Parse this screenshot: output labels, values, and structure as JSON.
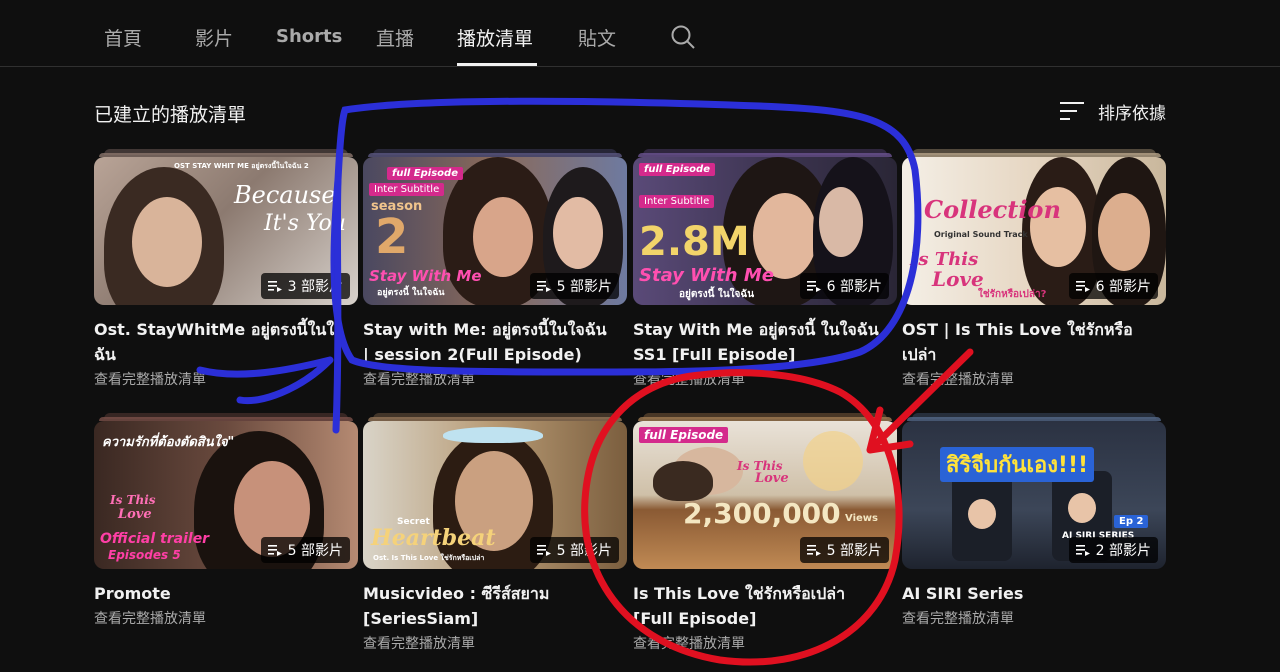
{
  "tabs": [
    {
      "label": "首頁"
    },
    {
      "label": "影片"
    },
    {
      "label": "Shorts"
    },
    {
      "label": "直播"
    },
    {
      "label": "播放清單"
    },
    {
      "label": "貼文"
    }
  ],
  "active_tab": "播放清單",
  "section": {
    "title": "已建立的播放清單",
    "sort_label": "排序依據"
  },
  "playlists": [
    {
      "title_line1": "Ost. StayWhitMe อยู่ตรงนี้ในใจ",
      "title_line2": "ฉัน",
      "video_count": "3 部影片",
      "view_all": "查看完整播放清單",
      "thumb_text": [
        "Because",
        "It's You",
        "OST STAY WHIT ME อยู่ตรงนี้ในใจฉัน 2"
      ]
    },
    {
      "title_line1": "Stay with Me: อยู่ตรงนี้ในใจฉัน",
      "title_line2": "| session 2(Full Episode)",
      "video_count": "5 部影片",
      "view_all": "查看完整播放清單",
      "thumb_text": [
        "full Episode",
        "Inter Subtitle",
        "season",
        "2",
        "Stay With Me",
        "อยู่ตรงนี้ ในใจฉัน"
      ]
    },
    {
      "title_line1": "Stay With Me อยู่ตรงนี้ ในใจฉัน",
      "title_line2": "SS1  [Full Episode]",
      "video_count": "6 部影片",
      "view_all": "查看完整播放清單",
      "thumb_text": [
        "full Episode",
        "Inter Subtitle",
        "2.8M",
        "Stay With Me",
        "อยู่ตรงนี้ ในใจฉัน"
      ]
    },
    {
      "title_line1": "OST | Is This Love ใช่รักหรือ",
      "title_line2": "เปล่า",
      "video_count": "6 部影片",
      "view_all": "查看完整播放清單",
      "thumb_text": [
        "Collection",
        "Original Sound Track",
        "Is This",
        "Love",
        "ใช่รักหรือเปล่า?"
      ]
    },
    {
      "title_line1": "Promote",
      "title_line2": "",
      "video_count": "5 部影片",
      "view_all": "查看完整播放清單",
      "thumb_text": [
        "ความรักที่ต้องตัดสินใจ\"",
        "Is This",
        "Love",
        "Official trailer",
        "Episodes 5"
      ]
    },
    {
      "title_line1": "Musicvideo : ซีรีส์สยาม",
      "title_line2": "[SeriesSiam]",
      "video_count": "5 部影片",
      "view_all": "查看完整播放清單",
      "thumb_text": [
        "Secret",
        "Heartbeat",
        "Ost. Is This Love ใช่รักหรือเปล่า"
      ]
    },
    {
      "title_line1": "Is This Love ใช่รักหรือเปล่า",
      "title_line2": "[Full Episode]",
      "video_count": "5 部影片",
      "view_all": "查看完整播放清單",
      "thumb_text": [
        "full Episode",
        "Is This",
        "Love",
        "2,300,000",
        "Views"
      ]
    },
    {
      "title_line1": "AI SIRI Series",
      "title_line2": "",
      "video_count": "2 部影片",
      "view_all": "查看完整播放清單",
      "thumb_text": [
        "สิริจีบกันเอง!!!",
        "Ep 2",
        "AI SIRI SERIES"
      ]
    }
  ],
  "colors": {
    "background": "#0f0f0f",
    "text_primary": "#f1f1f1",
    "text_secondary": "#aaaaaa",
    "annotation_blue": "#2b2fd8",
    "annotation_red": "#e01020"
  },
  "icons": [
    "search-icon",
    "sort-icon",
    "playlist-icon"
  ]
}
